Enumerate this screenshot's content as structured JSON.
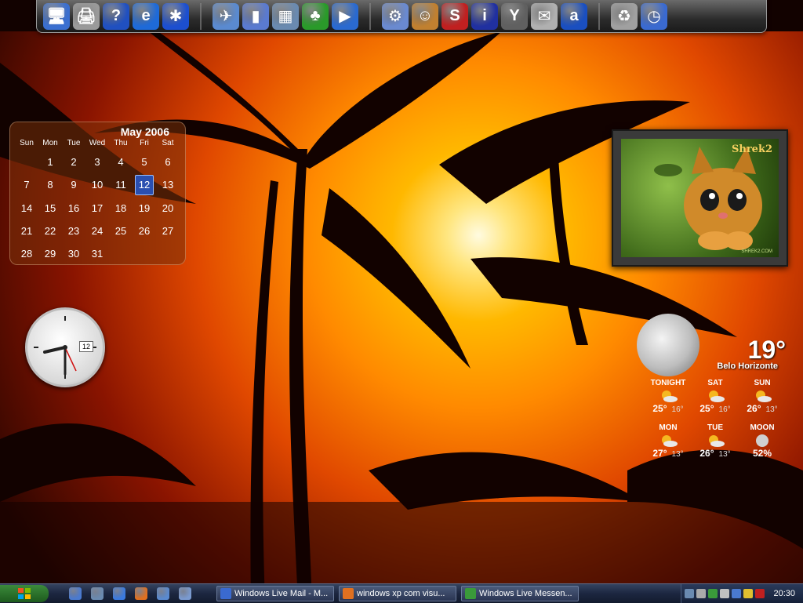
{
  "dock": {
    "icons": [
      {
        "name": "my-computer-icon",
        "color": "#3a6fd0",
        "glyph": "🖥"
      },
      {
        "name": "printer-icon",
        "color": "#9a9a9a",
        "glyph": "🖨"
      },
      {
        "name": "help-icon",
        "color": "#2050c0",
        "glyph": "?"
      },
      {
        "name": "internet-explorer-icon",
        "color": "#1e6ad8",
        "glyph": "e"
      },
      {
        "name": "bluetooth-icon",
        "color": "#1c4fd0",
        "glyph": "✱"
      },
      {
        "name": "network-places-icon",
        "color": "#5a8ad0",
        "glyph": "✈"
      },
      {
        "name": "documents-icon",
        "color": "#5a7ad0",
        "glyph": "▮"
      },
      {
        "name": "control-panel-icon",
        "color": "#6a8ab0",
        "glyph": "▦"
      },
      {
        "name": "messenger-icon",
        "color": "#2a9a2a",
        "glyph": "♣"
      },
      {
        "name": "media-player-icon",
        "color": "#2a6ad0",
        "glyph": "▶"
      },
      {
        "name": "settings-gear-icon",
        "color": "#6a8ad0",
        "glyph": "⚙"
      },
      {
        "name": "users-icon",
        "color": "#c08030",
        "glyph": "☺"
      },
      {
        "name": "se-icon",
        "color": "#c02020",
        "glyph": "S"
      },
      {
        "name": "info-icon",
        "color": "#2030a0",
        "glyph": "i"
      },
      {
        "name": "yahoo-icon",
        "color": "#606060",
        "glyph": "Y"
      },
      {
        "name": "mail-icon",
        "color": "#b0b0b0",
        "glyph": "✉"
      },
      {
        "name": "aim-icon",
        "color": "#1a4fc0",
        "glyph": "a"
      },
      {
        "name": "recycle-bin-icon",
        "color": "#a0a0a0",
        "glyph": "♻"
      },
      {
        "name": "clock-dock-icon",
        "color": "#3a6ad0",
        "glyph": "◷"
      }
    ]
  },
  "calendar": {
    "title": "May 2006",
    "days_of_week": [
      "Sun",
      "Mon",
      "Tue",
      "Wed",
      "Thu",
      "Fri",
      "Sat"
    ],
    "days": [
      "",
      "1",
      "2",
      "3",
      "4",
      "5",
      "6",
      "7",
      "8",
      "9",
      "10",
      "11",
      "12",
      "13",
      "14",
      "15",
      "16",
      "17",
      "18",
      "19",
      "20",
      "21",
      "22",
      "23",
      "24",
      "25",
      "26",
      "27",
      "28",
      "29",
      "30",
      "31"
    ],
    "today": "12"
  },
  "clock": {
    "date": "12",
    "time": "20:30"
  },
  "picture": {
    "logo": "Shrek2",
    "url": "SHREK2.COM"
  },
  "weather": {
    "temp": "19°",
    "city": "Belo Horizonte",
    "forecast": [
      {
        "label": "TONIGHT",
        "hi": "25°",
        "lo": "16°",
        "icon": "sun-cloud-icon"
      },
      {
        "label": "SAT",
        "hi": "25°",
        "lo": "16°",
        "icon": "sun-cloud-icon"
      },
      {
        "label": "SUN",
        "hi": "26°",
        "lo": "13°",
        "icon": "sun-cloud-icon"
      },
      {
        "label": "MON",
        "hi": "27°",
        "lo": "13°",
        "icon": "sun-cloud-icon"
      },
      {
        "label": "TUE",
        "hi": "26°",
        "lo": "13°",
        "icon": "sun-cloud-icon"
      },
      {
        "label": "MOON",
        "hi": "52%",
        "lo": "",
        "icon": "moon-icon"
      }
    ]
  },
  "taskbar": {
    "quick_launch": [
      {
        "name": "show-desktop-icon",
        "color": "#4a7ad0"
      },
      {
        "name": "switch-windows-icon",
        "color": "#6a8ab0"
      },
      {
        "name": "ie-quicklaunch-icon",
        "color": "#3a7ae0"
      },
      {
        "name": "firefox-quicklaunch-icon",
        "color": "#e07020"
      },
      {
        "name": "explorer-quicklaunch-icon",
        "color": "#5a8ad0"
      },
      {
        "name": "network-quicklaunch-icon",
        "color": "#7a9ad0"
      }
    ],
    "tasks": [
      {
        "label": "Windows Live Mail - M...",
        "color": "#3a6ad0"
      },
      {
        "label": "windows xp com visu...",
        "color": "#e07020"
      },
      {
        "label": "Windows Live Messen...",
        "color": "#3a9a3a"
      }
    ],
    "tray_icons": [
      "#6a8ab0",
      "#aaaaaa",
      "#3a9a3a",
      "#c0c0c0",
      "#4a7ad0",
      "#e0c030",
      "#c02020"
    ],
    "clock": "20:30"
  }
}
